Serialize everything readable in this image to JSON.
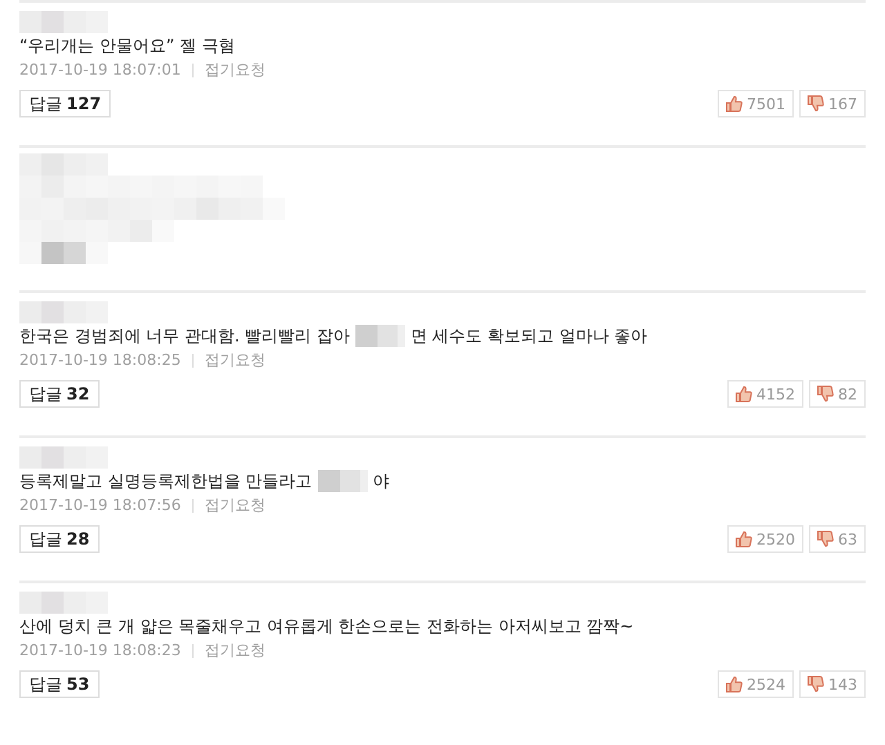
{
  "comments": [
    {
      "kind": "text",
      "segments": [
        {
          "kind": "text",
          "text": "“우리개는 안물어요” 젤 극혐"
        }
      ],
      "date": "2017-10-19 18:07:01",
      "report": "접기요청",
      "reply_label": "답글",
      "reply_count": "127",
      "likes": "7501",
      "dislikes": "167"
    },
    {
      "kind": "blurred"
    },
    {
      "kind": "text",
      "segments": [
        {
          "kind": "text",
          "text": "한국은 경범죄에 너무 관대함. 빨리빨리 잡아"
        },
        {
          "kind": "censor"
        },
        {
          "kind": "text",
          "text": "면 세수도 확보되고 얼마나 좋아"
        }
      ],
      "date": "2017-10-19 18:08:25",
      "report": "접기요청",
      "reply_label": "답글",
      "reply_count": "32",
      "likes": "4152",
      "dislikes": "82"
    },
    {
      "kind": "text",
      "segments": [
        {
          "kind": "text",
          "text": "등록제말고 실명등록제한법을 만들라고"
        },
        {
          "kind": "censor"
        },
        {
          "kind": "text",
          "text": "야"
        }
      ],
      "date": "2017-10-19 18:07:56",
      "report": "접기요청",
      "reply_label": "답글",
      "reply_count": "28",
      "likes": "2520",
      "dislikes": "63"
    },
    {
      "kind": "text",
      "segments": [
        {
          "kind": "text",
          "text": "산에 덩치 큰 개 얇은 목줄채우고 여유롭게 한손으로는 전화하는 아저씨보고 깜짝~"
        }
      ],
      "date": "2017-10-19 18:08:23",
      "report": "접기요청",
      "reply_label": "답글",
      "reply_count": "53",
      "likes": "2524",
      "dislikes": "143"
    }
  ]
}
